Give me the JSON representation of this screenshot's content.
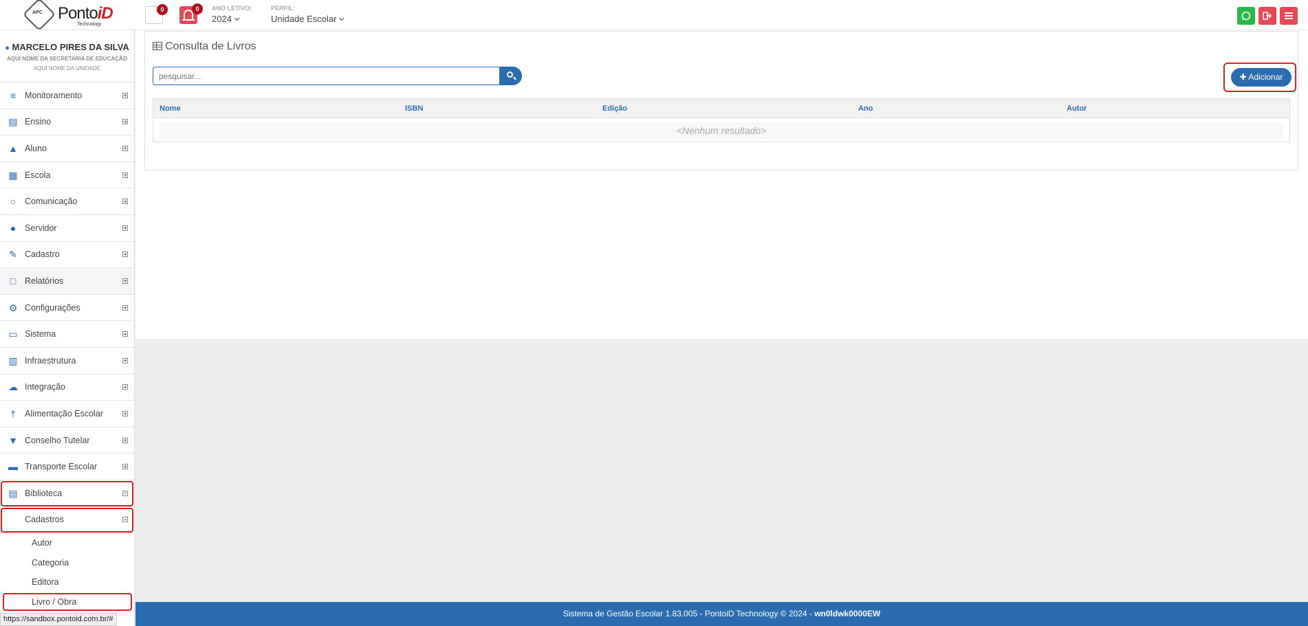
{
  "header": {
    "logo": {
      "brand_plain": "Ponto",
      "brand_accent": "iD",
      "sub": "Technology",
      "hex_text": "APC"
    },
    "notif1_count": "0",
    "notif2_count": "0",
    "ano_label": "ANO LETIVO:",
    "ano_value": "2024",
    "perfil_label": "PERFIL:",
    "perfil_value": "Unidade Escolar"
  },
  "user": {
    "name": "MARCELO PIRES DA SILVA",
    "secretaria": "AQUI NOME DA SECRETARIA DE EDUCAÇÃO",
    "unidade": "AQUI NOME DA UNIDADE"
  },
  "sidebar": {
    "items": [
      {
        "label": "Monitoramento",
        "icon": "sliders-icon"
      },
      {
        "label": "Ensino",
        "icon": "book-icon"
      },
      {
        "label": "Aluno",
        "icon": "graduation-cap-icon"
      },
      {
        "label": "Escola",
        "icon": "institution-icon"
      },
      {
        "label": "Comunicação",
        "icon": "chat-icon"
      },
      {
        "label": "Servidor",
        "icon": "user-icon"
      },
      {
        "label": "Cadastro",
        "icon": "edit-icon"
      },
      {
        "label": "Relatórios",
        "icon": "document-icon"
      },
      {
        "label": "Configurações",
        "icon": "gear-icon"
      },
      {
        "label": "Sistema",
        "icon": "monitor-icon"
      },
      {
        "label": "Infraestrutura",
        "icon": "building-icon"
      },
      {
        "label": "Integração",
        "icon": "cloud-icon"
      },
      {
        "label": "Alimentação Escolar",
        "icon": "cutlery-icon"
      },
      {
        "label": "Conselho Tutelar",
        "icon": "shield-icon"
      },
      {
        "label": "Transporte Escolar",
        "icon": "car-icon"
      },
      {
        "label": "Biblioteca",
        "icon": "book-icon"
      }
    ],
    "sub_group": "Cadastros",
    "sub_items": [
      "Autor",
      "Categoria",
      "Editora",
      "Livro / Obra"
    ]
  },
  "main": {
    "title": "Consulta de Livros",
    "search_placeholder": "pesquisar...",
    "add_label": "Adicionar",
    "columns": [
      "Nome",
      "ISBN",
      "Edição",
      "Ano",
      "Autor"
    ],
    "empty_text": "<Nenhum resultado>"
  },
  "footer": {
    "text": "Sistema de Gestão Escolar 1.83.005 - PontoiD Technology © 2024 - ",
    "code": "wn0ldwk0000EW"
  },
  "statusbar": "https://sandbox.pontoid.com.br/#"
}
